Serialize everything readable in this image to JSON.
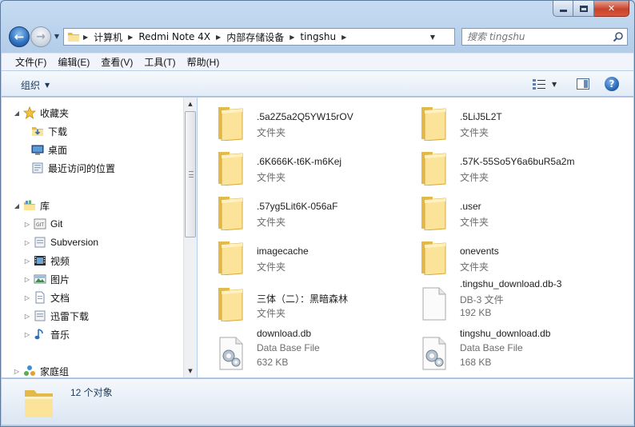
{
  "window": {
    "caption": {
      "minimize": "",
      "maximize": "",
      "close": "✕"
    }
  },
  "nav": {
    "back_glyph": "←",
    "forward_glyph": "→",
    "breadcrumbs": [
      "计算机",
      "Redmi Note 4X",
      "内部存储设备",
      "tingshu"
    ],
    "search_placeholder": "搜索 tingshu",
    "refresh_glyph": "↻"
  },
  "menu": {
    "items": [
      "文件(F)",
      "编辑(E)",
      "查看(V)",
      "工具(T)",
      "帮助(H)"
    ]
  },
  "commandbar": {
    "organize_label": "组织",
    "help_glyph": "?"
  },
  "navpane": {
    "favorites": {
      "label": "收藏夹",
      "items": [
        "下载",
        "桌面",
        "最近访问的位置"
      ]
    },
    "libraries": {
      "label": "库",
      "items": [
        "Git",
        "Subversion",
        "视频",
        "图片",
        "文档",
        "迅雷下载",
        "音乐"
      ]
    },
    "homegroup": {
      "label": "家庭组"
    }
  },
  "files": [
    {
      "name": ".5a2Z5a2Q5YW15rOV",
      "type": "文件夹",
      "kind": "folder"
    },
    {
      "name": ".5LiJ5L2T",
      "type": "文件夹",
      "kind": "folder"
    },
    {
      "name": ".6K666K-t6K-m6Kej",
      "type": "文件夹",
      "kind": "folder"
    },
    {
      "name": ".57K-55So5Y6a6buR5a2m",
      "type": "文件夹",
      "kind": "folder"
    },
    {
      "name": ".57yg5Lit6K-056aF",
      "type": "文件夹",
      "kind": "folder"
    },
    {
      "name": ".user",
      "type": "文件夹",
      "kind": "folder"
    },
    {
      "name": "imagecache",
      "type": "文件夹",
      "kind": "folder"
    },
    {
      "name": "onevents",
      "type": "文件夹",
      "kind": "folder"
    },
    {
      "name": "三体（二）：黑暗森林",
      "type": "文件夹",
      "kind": "folder"
    },
    {
      "name": ".tingshu_download.db-3",
      "type": "DB-3 文件",
      "size": "192 KB",
      "kind": "blank-file"
    },
    {
      "name": "download.db",
      "type": "Data Base File",
      "size": "632 KB",
      "kind": "db-file"
    },
    {
      "name": "tingshu_download.db",
      "type": "Data Base File",
      "size": "168 KB",
      "kind": "db-file"
    }
  ],
  "details": {
    "count": "12 个对象"
  },
  "colors": {
    "folder_light": "#fbe8a4",
    "folder_dark": "#e3b94a",
    "accent": "#2c6fbe"
  }
}
